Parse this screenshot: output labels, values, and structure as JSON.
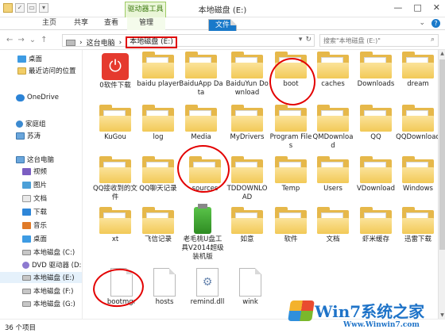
{
  "window": {
    "title": "本地磁盘 (E:)",
    "ribbon_tool_label": "驱动器工具",
    "min": "—",
    "max": "□",
    "close": "✕"
  },
  "tabs": [
    {
      "label": "文件"
    },
    {
      "label": "主页"
    },
    {
      "label": "共享"
    },
    {
      "label": "查看"
    },
    {
      "label": "管理"
    }
  ],
  "nav": {
    "back": "←",
    "forward": "→",
    "up": "↑"
  },
  "address": {
    "crumbs": [
      "这台电脑",
      "本地磁盘 (E:)"
    ],
    "separator": "›",
    "dropdown": "▾",
    "refresh": "↻"
  },
  "search": {
    "placeholder": "搜索\"本地磁盘 (E:)\""
  },
  "sidebar": [
    {
      "label": "桌面",
      "icon": "desktop-folder-icon"
    },
    {
      "label": "最近访问的位置",
      "icon": "recent-places-icon"
    },
    {
      "label": "OneDrive",
      "icon": "onedrive-cloud-icon"
    },
    {
      "label": "家庭组",
      "icon": "homegroup-icon"
    },
    {
      "label": "苏涛",
      "icon": "user-icon"
    },
    {
      "label": "这台电脑",
      "icon": "this-pc-icon"
    },
    {
      "label": "视频",
      "icon": "videos-folder-icon"
    },
    {
      "label": "图片",
      "icon": "pictures-folder-icon"
    },
    {
      "label": "文档",
      "icon": "documents-folder-icon"
    },
    {
      "label": "下载",
      "icon": "downloads-folder-icon"
    },
    {
      "label": "音乐",
      "icon": "music-folder-icon"
    },
    {
      "label": "桌面",
      "icon": "desktop-folder-icon"
    },
    {
      "label": "本地磁盘 (C:)",
      "icon": "drive-icon"
    },
    {
      "label": "DVD 驱动器 (D:)",
      "icon": "dvd-drive-icon"
    },
    {
      "label": "本地磁盘 (E:)",
      "icon": "drive-icon"
    },
    {
      "label": "本地磁盘 (F:)",
      "icon": "drive-icon"
    },
    {
      "label": "本地磁盘 (G:)",
      "icon": "drive-icon"
    }
  ],
  "files": [
    {
      "label": "0软件下载",
      "kind": "app-red"
    },
    {
      "label": "baidu player",
      "kind": "folder"
    },
    {
      "label": "BaiduApp Data",
      "kind": "folder"
    },
    {
      "label": "BaiduYun Download",
      "kind": "folder"
    },
    {
      "label": "boot",
      "kind": "folder"
    },
    {
      "label": "caches",
      "kind": "folder"
    },
    {
      "label": "Downloads",
      "kind": "folder"
    },
    {
      "label": "dream",
      "kind": "folder"
    },
    {
      "label": "KuGou",
      "kind": "folder"
    },
    {
      "label": "log",
      "kind": "folder"
    },
    {
      "label": "Media",
      "kind": "folder"
    },
    {
      "label": "MyDrivers",
      "kind": "folder"
    },
    {
      "label": "Program Files",
      "kind": "folder"
    },
    {
      "label": "QMDownload",
      "kind": "folder"
    },
    {
      "label": "QQ",
      "kind": "folder"
    },
    {
      "label": "QQDownload",
      "kind": "folder"
    },
    {
      "label": "QQ接收到的文件",
      "kind": "folder"
    },
    {
      "label": "QQ聊天记录",
      "kind": "folder"
    },
    {
      "label": "sources",
      "kind": "folder"
    },
    {
      "label": "TDDOWNLOAD",
      "kind": "folder"
    },
    {
      "label": "Temp",
      "kind": "folder"
    },
    {
      "label": "Users",
      "kind": "folder"
    },
    {
      "label": "VDownload",
      "kind": "folder"
    },
    {
      "label": "Windows",
      "kind": "folder"
    },
    {
      "label": "xt",
      "kind": "folder"
    },
    {
      "label": "飞信记录",
      "kind": "folder"
    },
    {
      "label": "老毛桃U盘工具V2014超级装机版",
      "kind": "app-green"
    },
    {
      "label": "如意",
      "kind": "folder"
    },
    {
      "label": "软件",
      "kind": "folder"
    },
    {
      "label": "文档",
      "kind": "folder"
    },
    {
      "label": "虾米缓存",
      "kind": "folder"
    },
    {
      "label": "迅雷下载",
      "kind": "folder"
    },
    {
      "label": "bootmgr",
      "kind": "file"
    },
    {
      "label": "hosts",
      "kind": "file"
    },
    {
      "label": "remind.dll",
      "kind": "dll"
    },
    {
      "label": "wink",
      "kind": "file"
    }
  ],
  "status": {
    "count": "36 个项目"
  },
  "watermark": {
    "top": "Win7系统之家",
    "bottom": "Www.Winwin7.com"
  }
}
